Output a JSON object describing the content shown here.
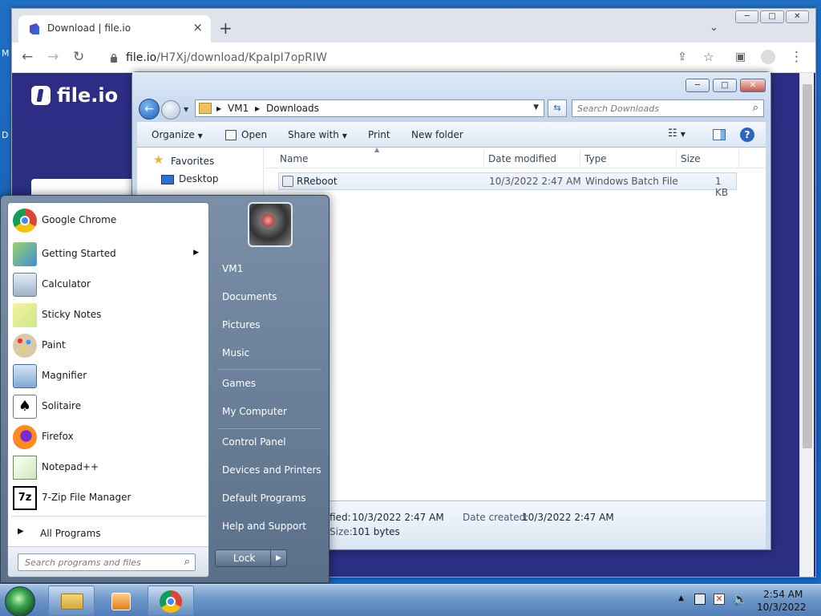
{
  "chrome": {
    "tab_title": "Download | file.io",
    "url_host": "file.io",
    "url_path": "/H7Xj/download/KpaIpI7opRIW",
    "window_buttons": [
      "─",
      "□",
      "✕"
    ]
  },
  "fileio": {
    "brand": "file.io"
  },
  "explorer": {
    "path": [
      "VM1",
      "Downloads"
    ],
    "search_placeholder": "Search Downloads",
    "toolbar": {
      "organize": "Organize",
      "open": "Open",
      "share_with": "Share with",
      "print": "Print",
      "new_folder": "New folder"
    },
    "nav": {
      "favorites": "Favorites",
      "desktop": "Desktop"
    },
    "columns": {
      "name": "Name",
      "date": "Date modified",
      "type": "Type",
      "size": "Size"
    },
    "file": {
      "name": "RReboot",
      "date": "10/3/2022 2:47 AM",
      "type": "Windows Batch File",
      "size": "1 KB"
    },
    "details": {
      "modified_label": "fied:",
      "modified": "10/3/2022 2:47 AM",
      "created_label": "Date created:",
      "created": "10/3/2022 2:47 AM",
      "size_label": "Size:",
      "size": "101 bytes"
    }
  },
  "start_menu": {
    "programs": [
      {
        "label": "Google Chrome",
        "icon": "chrome-icon"
      },
      {
        "label": "Getting Started",
        "icon": "getting-started-icon",
        "submenu": true
      },
      {
        "label": "Calculator",
        "icon": "calculator-icon"
      },
      {
        "label": "Sticky Notes",
        "icon": "sticky-notes-icon"
      },
      {
        "label": "Paint",
        "icon": "paint-icon"
      },
      {
        "label": "Magnifier",
        "icon": "magnifier-icon"
      },
      {
        "label": "Solitaire",
        "icon": "solitaire-icon"
      },
      {
        "label": "Firefox",
        "icon": "firefox-icon"
      },
      {
        "label": "Notepad++",
        "icon": "notepadpp-icon"
      },
      {
        "label": "7-Zip File Manager",
        "icon": "7zip-icon"
      }
    ],
    "all_programs": "All Programs",
    "search_placeholder": "Search programs and files",
    "right": [
      "VM1",
      "Documents",
      "Pictures",
      "Music",
      "Games",
      "My Computer",
      "Control Panel",
      "Devices and Printers",
      "Default Programs",
      "Help and Support"
    ],
    "lock": "Lock"
  },
  "taskbar": {
    "time": "2:54 AM",
    "date": "10/3/2022"
  },
  "desktop": {
    "edge_letters": [
      "M",
      "D"
    ]
  }
}
